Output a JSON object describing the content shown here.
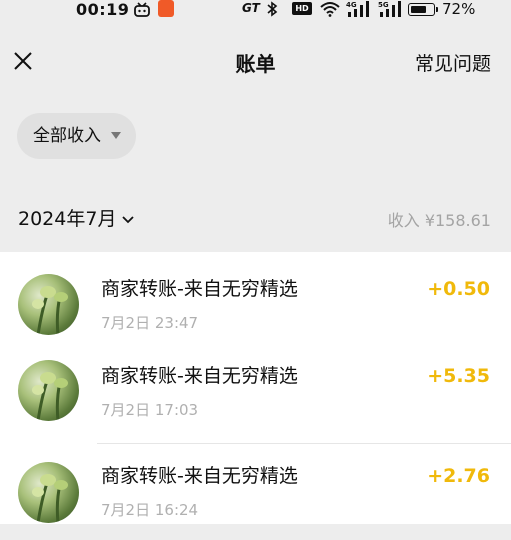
{
  "status_bar": {
    "time": "00:19",
    "network_label": "GT",
    "hd_label": "HD",
    "battery_percent": 72,
    "battery_label": "72%"
  },
  "nav": {
    "title": "账单",
    "faq_label": "常见问题",
    "close_icon": "close-icon"
  },
  "filter": {
    "label": "全部收入",
    "icon": "caret-down-icon"
  },
  "month_header": {
    "month_label": "2024年7月",
    "summary": "收入 ¥158.61",
    "icon": "chevron-down-icon"
  },
  "transactions": [
    {
      "title": "商家转账-来自无穷精选",
      "time": "7月2日 23:47",
      "amount": "+0.50"
    },
    {
      "title": "商家转账-来自无穷精选",
      "time": "7月2日 17:03",
      "amount": "+5.35"
    },
    {
      "title": "商家转账-来自无穷精选",
      "time": "7月2日 16:24",
      "amount": "+2.76"
    }
  ],
  "colors": {
    "accent_amount": "#f0b90b",
    "background": "#ededed",
    "secondary_text": "#a4a4a4"
  }
}
